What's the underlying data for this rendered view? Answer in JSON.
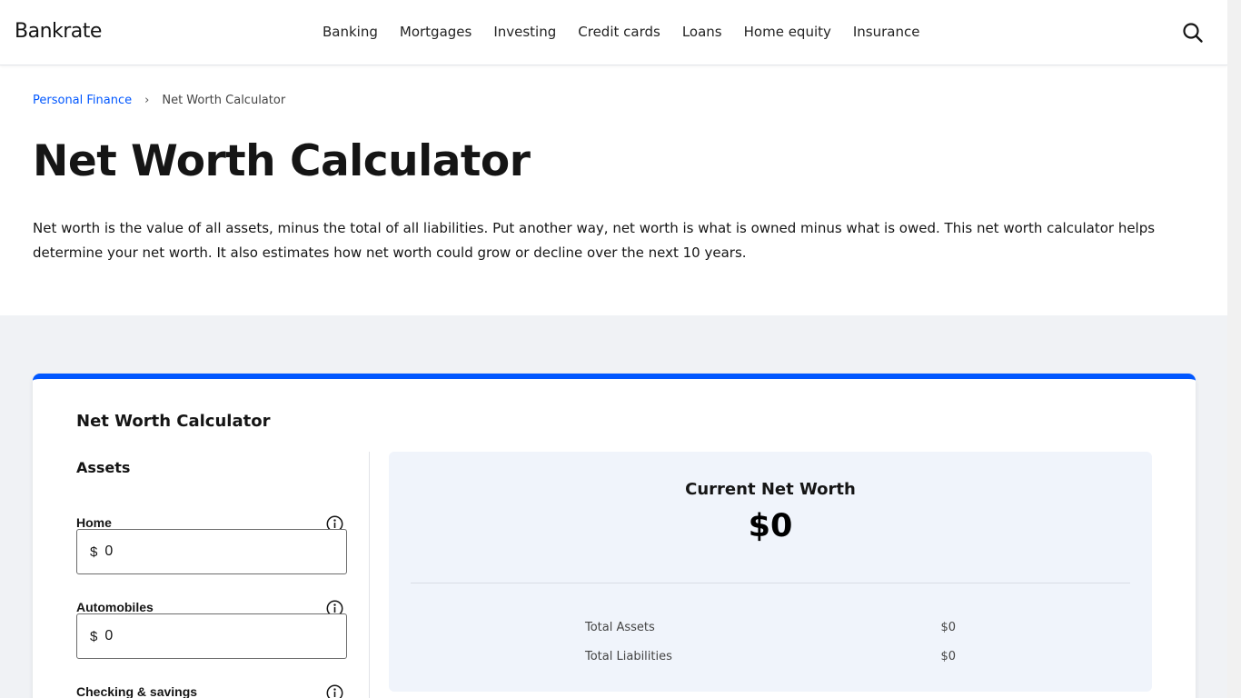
{
  "header": {
    "logo": "Bankrate",
    "nav": [
      "Banking",
      "Mortgages",
      "Investing",
      "Credit cards",
      "Loans",
      "Home equity",
      "Insurance"
    ],
    "search_icon": "search-icon"
  },
  "breadcrumb": {
    "parent": "Personal Finance",
    "separator": "›",
    "current": "Net Worth Calculator"
  },
  "page": {
    "title": "Net Worth Calculator",
    "intro": "Net worth is the value of all assets, minus the total of all liabilities. Put another way, net worth is what is owned minus what is owed. This net worth calculator helps determine your net worth. It also estimates how net worth could grow or decline over the next 10 years."
  },
  "calculator": {
    "title": "Net Worth Calculator",
    "assets_heading": "Assets",
    "currency_symbol": "$",
    "fields": [
      {
        "label": "Home",
        "value": "0"
      },
      {
        "label": "Automobiles",
        "value": "0"
      },
      {
        "label": "Checking & savings",
        "value": ""
      }
    ],
    "summary": {
      "title": "Current Net Worth",
      "value": "$0",
      "rows": [
        {
          "label": "Total Assets",
          "value": "$0"
        },
        {
          "label": "Total Liabilities",
          "value": "$0"
        }
      ]
    }
  },
  "colors": {
    "accent": "#0157ff",
    "section_bg": "#f0f2f5",
    "summary_bg": "#f0f4fb"
  }
}
